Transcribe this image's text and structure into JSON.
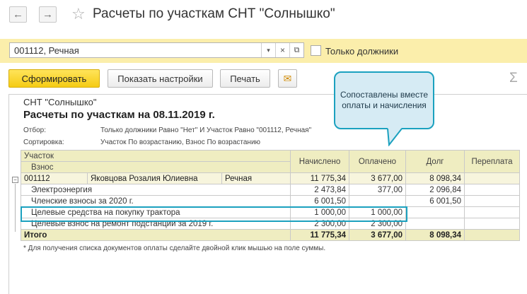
{
  "window": {
    "title": "Расчеты по участкам СНТ \"Солнышко\""
  },
  "nav": {
    "back": "←",
    "forward": "→",
    "star": "☆"
  },
  "filter": {
    "value": "001112, Речная",
    "dropdown_glyph": "▾",
    "clear_glyph": "×",
    "open_glyph": "⧉",
    "only_debtors_label": "Только должники",
    "only_debtors_checked": false
  },
  "toolbar": {
    "generate_label": "Сформировать",
    "settings_label": "Показать настройки",
    "print_label": "Печать",
    "mail_glyph": "✉",
    "sigma": "Σ"
  },
  "report": {
    "org": "СНТ \"Солнышко\"",
    "heading": "Расчеты по участкам на 08.11.2019 г.",
    "filter_label": "Отбор:",
    "filter_value": "Только должники Равно \"Нет\" И Участок Равно \"001112, Речная\"",
    "sort_label": "Сортировка:",
    "sort_value": "Участок По возрастанию, Взнос По возрастанию",
    "columns": {
      "plot": "Участок",
      "fee": "Взнос",
      "accrued": "Начислено",
      "paid": "Оплачено",
      "debt": "Долг",
      "overpaid": "Переплата"
    },
    "group": {
      "plot": "001112",
      "owner": "Яковцова Розалия Юлиевна",
      "street": "Речная",
      "accrued": "11 775,34",
      "paid": "3 677,00",
      "debt": "8 098,34",
      "overpaid": ""
    },
    "rows": [
      {
        "name": "Электроэнергия",
        "accrued": "2 473,84",
        "paid": "377,00",
        "debt": "2 096,84",
        "overpaid": ""
      },
      {
        "name": "Членские взносы за 2020 г.",
        "accrued": "6 001,50",
        "paid": "",
        "debt": "6 001,50",
        "overpaid": ""
      },
      {
        "name": "Целевые средства на покупку трактора",
        "accrued": "1 000,00",
        "paid": "1 000,00",
        "debt": "",
        "overpaid": ""
      },
      {
        "name": "Целевые взнос на ремонт подстанции за 2019 г.",
        "accrued": "2 300,00",
        "paid": "2 300,00",
        "debt": "",
        "overpaid": ""
      }
    ],
    "total": {
      "label": "Итого",
      "accrued": "11 775,34",
      "paid": "3 677,00",
      "debt": "8 098,34",
      "overpaid": ""
    },
    "note": "* Для получения списка документов оплаты сделайте двойной клик мышью на поле суммы."
  },
  "callout": {
    "text": "Сопоставлены вместе оплаты и начисления"
  },
  "colors": {
    "accent": "#1ba1bf",
    "filter_bg": "#fbeeab",
    "primary_button": "#f5cc14",
    "table_header": "#efedc1"
  }
}
